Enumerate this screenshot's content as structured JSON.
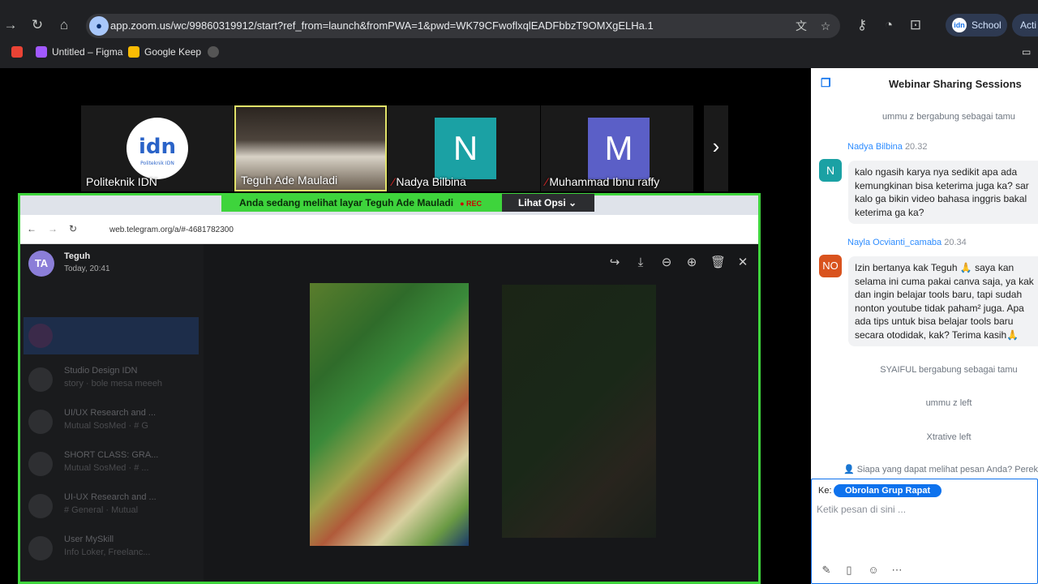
{
  "browser": {
    "url": "app.zoom.us/wc/99860319912/start?ref_from=launch&fromPWA=1&pwd=WK79CFwoflxqlEADFbbzT9OMXgELHa.1",
    "profile_label": "School",
    "profile_initials": "idn",
    "action_label": "Acti",
    "bookmarks": [
      {
        "label": ""
      },
      {
        "label": "Untitled – Figma"
      },
      {
        "label": "Google Keep"
      }
    ]
  },
  "participants": [
    {
      "name": "Politeknik IDN",
      "muted": false
    },
    {
      "name": "Teguh Ade Mauladi",
      "muted": false
    },
    {
      "name": "Nadya Bilbina",
      "muted": true,
      "initial": "N",
      "color": "#1ba1a4"
    },
    {
      "name": "Muhammad Ibnu raffy",
      "muted": true,
      "initial": "M",
      "color": "#5b5fc7"
    }
  ],
  "logo_text": "Politeknik IDN",
  "share": {
    "banner": "Anda sedang melihat layar  Teguh Ade Mauladi",
    "rec": "REC",
    "options": "Lihat Opsi",
    "inner_url": "web.telegram.org/a/#-4681782300",
    "viewer_name": "Teguh",
    "viewer_time": "Today, 20:41",
    "viewer_initials": "TA",
    "chat_list": [
      {
        "title": "Studio Design IDN",
        "preview": "story · bole mesa meeeh"
      },
      {
        "title": "UI/UX Research and ...",
        "preview": "Mutual SosMed · # G"
      },
      {
        "title": "SHORT CLASS: GRA...",
        "preview": "Mutual SosMed · # ..."
      },
      {
        "title": "UI-UX Research and ...",
        "preview": "# General · Mutual"
      },
      {
        "title": "User MySkill",
        "preview": "Info Loker, Freelanc..."
      }
    ]
  },
  "chat": {
    "title": "Webinar Sharing Sessions",
    "sys1": "ummu z bergabung sebagai tamu",
    "messages": [
      {
        "sender": "Nadya Bilbina",
        "time": "20.32",
        "initials": "N",
        "color": "#1ba1a4",
        "lines": [
          "kalo ngasih karya nya sedikit apa ada",
          "kemungkinan bisa keterima juga ka? sar",
          "kalo ga bikin video bahasa inggris bakal",
          "keterima ga ka?"
        ]
      },
      {
        "sender": "Nayla Ocvianti_camaba",
        "time": "20.34",
        "initials": "NO",
        "color": "#d9531e",
        "lines": [
          "Izin bertanya kak Teguh 🙏 saya kan",
          "selama ini cuma pakai canva saja, ya kak",
          "dan ingin belajar tools baru, tapi sudah",
          "nonton youtube tidak paham² juga. Apa",
          "ada tips untuk bisa belajar tools baru",
          "secara otodidak, kak? Terima kasih🙏"
        ]
      }
    ],
    "sys2": "SYAIFUL bergabung sebagai tamu",
    "sys3": "ummu z left",
    "sys4": "Xtrative left",
    "who_can_see": "Siapa yang dapat melihat pesan Anda? Perekaman",
    "to_label": "Ke:",
    "to_chip": "Obrolan Grup Rapat",
    "placeholder": "Ketik pesan di sini ..."
  }
}
